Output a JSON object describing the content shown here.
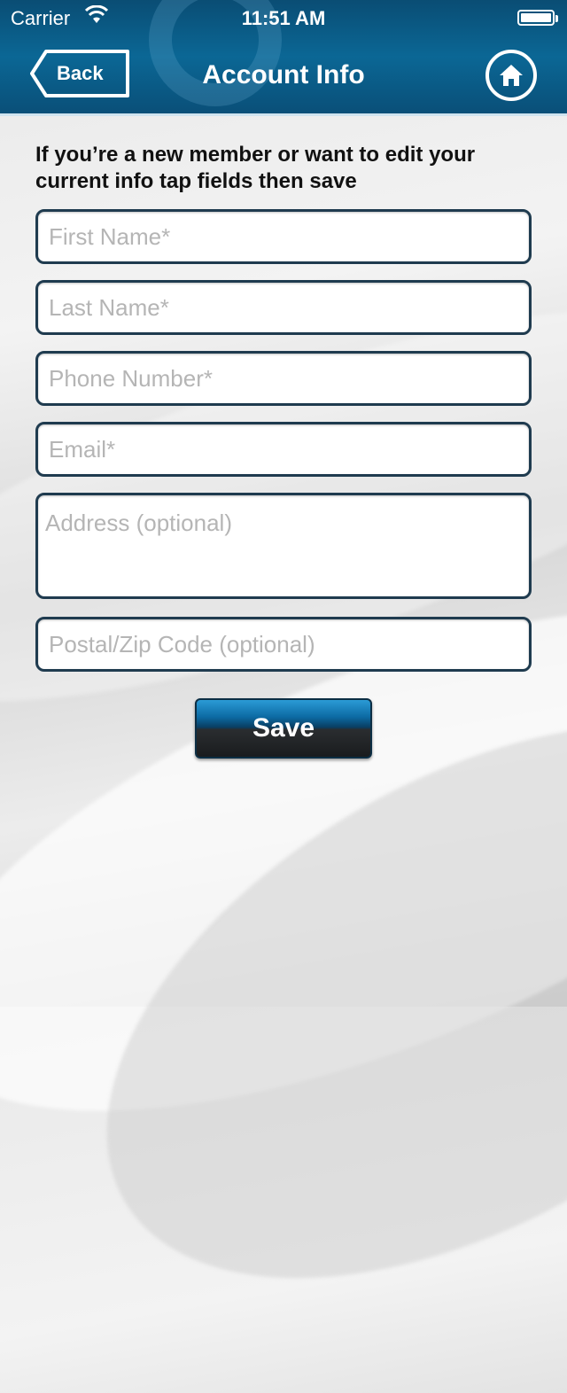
{
  "status_bar": {
    "carrier": "Carrier",
    "wifi_icon": "wifi-icon",
    "time": "11:51 AM",
    "battery_icon": "battery-icon"
  },
  "header": {
    "back_label": "Back",
    "title": "Account Info",
    "home_icon": "home-icon",
    "background_color": "#0b6795"
  },
  "form": {
    "instruction": "If you’re a new member or want to edit your current info tap fields then save",
    "fields": {
      "first_name": {
        "value": "",
        "placeholder": "First Name*"
      },
      "last_name": {
        "value": "",
        "placeholder": "Last Name*"
      },
      "phone": {
        "value": "",
        "placeholder": "Phone Number*"
      },
      "email": {
        "value": "",
        "placeholder": "Email*"
      },
      "address": {
        "value": "",
        "placeholder": "Address (optional)"
      },
      "postal": {
        "value": "",
        "placeholder": "Postal/Zip Code (optional)"
      }
    },
    "save_label": "Save"
  }
}
